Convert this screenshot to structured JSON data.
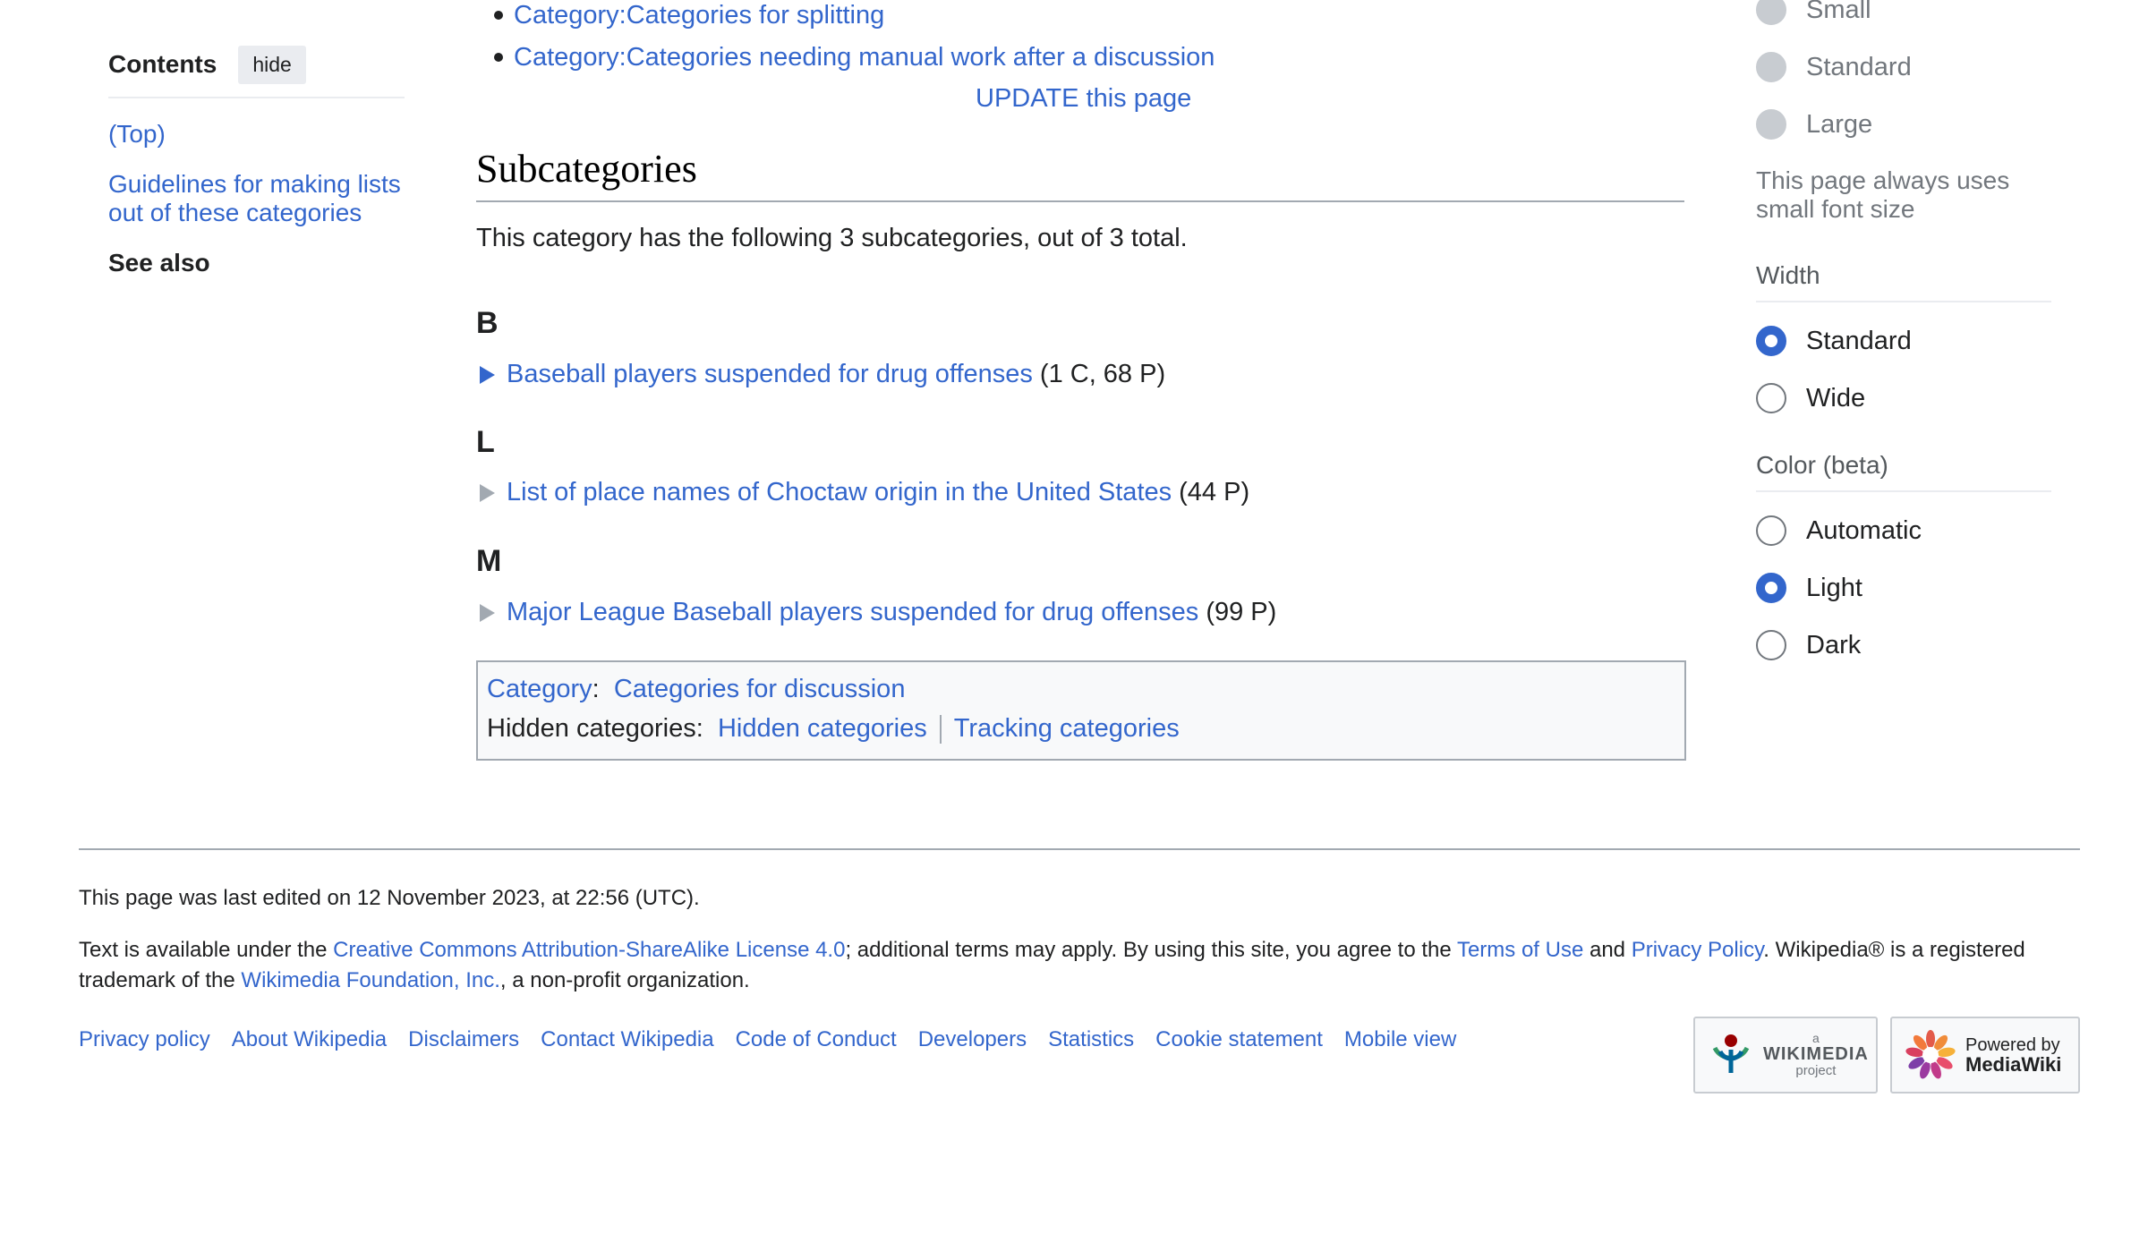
{
  "toc": {
    "title": "Contents",
    "hide_label": "hide",
    "items": [
      "(Top)",
      "Guidelines for making lists out of these categories",
      "See also"
    ]
  },
  "categories": [
    "Category:Categories for splitting",
    "Category:Categories needing manual work after a discussion"
  ],
  "update_link": "UPDATE this page",
  "subcategories": {
    "heading": "Subcategories",
    "description": "This category has the following 3 subcategories, out of 3 total.",
    "groups": [
      {
        "letter": "B",
        "title": "Baseball players suspended for drug offenses",
        "count": "(1 C, 68 P)",
        "expandable": true
      },
      {
        "letter": "L",
        "title": "List of place names of Choctaw origin in the United States",
        "count": "(44 P)",
        "expandable": false
      },
      {
        "letter": "M",
        "title": "Major League Baseball players suspended for drug offenses",
        "count": "(99 P)",
        "expandable": false
      }
    ]
  },
  "catlinks": {
    "category_label": "Category",
    "category_value": "Categories for discussion",
    "hidden_label": "Hidden categories:",
    "hidden_values": [
      "Hidden categories",
      "Tracking categories"
    ]
  },
  "appearance": {
    "text_options": [
      "Small",
      "Standard",
      "Large"
    ],
    "text_note": "This page always uses small font size",
    "width_label": "Width",
    "width_options": [
      "Standard",
      "Wide"
    ],
    "width_selected": "Standard",
    "color_label": "Color (beta)",
    "color_options": [
      "Automatic",
      "Light",
      "Dark"
    ],
    "color_selected": "Light"
  },
  "footer": {
    "last_edited": "This page was last edited on 12 November 2023, at 22:56 (UTC).",
    "license_prefix": "Text is available under the ",
    "license_link": "Creative Commons Attribution-ShareAlike License 4.0",
    "license_mid": "; additional terms may apply. By using this site, you agree to the ",
    "terms_link": "Terms of Use",
    "and": " and ",
    "privacy_link": "Privacy Policy",
    "license_mid2": ". Wikipedia® is a registered trademark of the ",
    "foundation_link": "Wikimedia Foundation, Inc.",
    "license_suffix": ", a non-profit organization.",
    "places": [
      "Privacy policy",
      "About Wikipedia",
      "Disclaimers",
      "Contact Wikipedia",
      "Code of Conduct",
      "Developers",
      "Statistics",
      "Cookie statement",
      "Mobile view"
    ],
    "badge_wikimedia": {
      "small": "a",
      "name": "WIKIMEDIA",
      "sub": "project"
    },
    "badge_mediawiki": {
      "line1": "Powered by",
      "line2": "MediaWiki"
    }
  }
}
